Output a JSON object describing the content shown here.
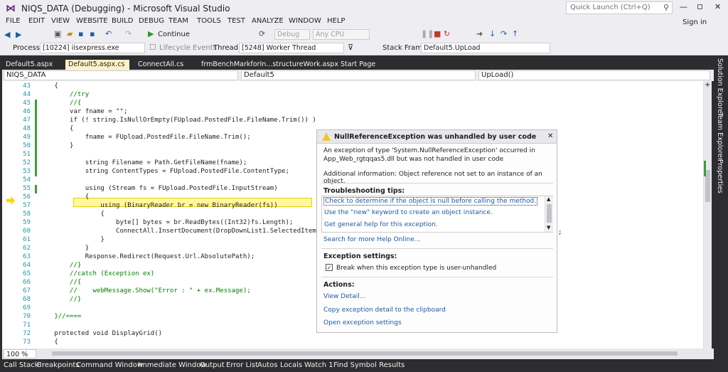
{
  "titlebar": {
    "title": "NIQS_DATA (Debugging) - Microsoft Visual Studio",
    "quick_launch": "Quick Launch (Ctrl+Q)",
    "signin": "Sign in",
    "minimize": "—",
    "restore": "▫",
    "close": "✕"
  },
  "menu": [
    "FILE",
    "EDIT",
    "VIEW",
    "WEBSITE",
    "BUILD",
    "DEBUG",
    "TEAM",
    "TOOLS",
    "TEST",
    "ANALYZE",
    "WINDOW",
    "HELP"
  ],
  "toolbar": {
    "continue": "Continue",
    "config": "Debug",
    "platform": "Any CPU"
  },
  "debugbar": {
    "process_label": "Process:",
    "process_value": "[10224] iisexpress.exe",
    "lifecycle": "Lifecycle Events",
    "thread_label": "Thread:",
    "thread_value": "[5248] Worker Thread",
    "stack_label": "Stack Frame:",
    "stack_value": "Default5.UpLoad"
  },
  "tabs": [
    "Default5.aspx",
    "Default5.aspx.cs",
    "ConnectAll.cs",
    "frmBenchMarkforIn...structureWork.aspx",
    "Start Page"
  ],
  "nav": {
    "project": "NIQS_DATA",
    "class": "Default5",
    "member": "UpLoad()"
  },
  "zoom": "100 %",
  "lines": [
    {
      "n": "43",
      "t": "        {"
    },
    {
      "n": "44",
      "t": "            //try"
    },
    {
      "n": "45",
      "t": "            //{"
    },
    {
      "n": "46",
      "t": "            var fname = \"\";"
    },
    {
      "n": "47",
      "t": "            if (! string.IsNullOrEmpty(FUpload.PostedFile.FileName.Trim()) )"
    },
    {
      "n": "48",
      "t": "            {"
    },
    {
      "n": "49",
      "t": "                fname = FUpload.PostedFile.FileName.Trim();"
    },
    {
      "n": "50",
      "t": "            }"
    },
    {
      "n": "51",
      "t": ""
    },
    {
      "n": "52",
      "t": "                string Filename = Path.GetFileName(fname);"
    },
    {
      "n": "53",
      "t": "                string ContentTypes = FUpload.PostedFile.ContentType;"
    },
    {
      "n": "54",
      "t": ""
    },
    {
      "n": "55",
      "t": "                using (Stream fs = FUpload.PostedFile.InputStream)"
    },
    {
      "n": "56",
      "t": "                {"
    },
    {
      "n": "57",
      "t": "                    using (BinaryReader br = new BinaryReader(fs))"
    },
    {
      "n": "58",
      "t": "                    {"
    },
    {
      "n": "59",
      "t": "                        byte[] bytes = br.ReadBytes((Int32)fs.Length);"
    },
    {
      "n": "60",
      "t": "                        ConnectAll.InsertDocument(DropDownList1.SelectedItem.T"
    },
    {
      "n": "61",
      "t": "                    }"
    },
    {
      "n": "62",
      "t": "                }"
    },
    {
      "n": "63",
      "t": "                Response.Redirect(Request.Url.AbsolutePath);"
    },
    {
      "n": "64",
      "t": "            //}"
    },
    {
      "n": "65",
      "t": "            //catch (Exception ex)"
    },
    {
      "n": "66",
      "t": "            //{"
    },
    {
      "n": "67",
      "t": "            //    webMessage.Show(\"Error : \" + ex.Message);"
    },
    {
      "n": "68",
      "t": "            //}"
    },
    {
      "n": "69",
      "t": ""
    },
    {
      "n": "70",
      "t": "        }//===="
    },
    {
      "n": "71",
      "t": ""
    },
    {
      "n": "72",
      "t": "        protected void DisplayGrid()"
    },
    {
      "n": "73",
      "t": "        {"
    }
  ],
  "code_tail": ";",
  "exception": {
    "title": "NullReferenceException was unhandled by user code",
    "desc1": "An exception of type 'System.NullReferenceException' occurred in",
    "desc2": "App_Web_rgtqqas5.dll but was not handled in user code",
    "info": "Additional information: Object reference not set to an instance of an object.",
    "tips_title": "Troubleshooting tips:",
    "tips": [
      "Check to determine if the object is null before calling the method.",
      "Use the \"new\" keyword to create an object instance.",
      "Get general help for this exception."
    ],
    "help_online": "Search for more Help Online...",
    "settings_title": "Exception settings:",
    "checkbox_label": "Break when this exception type is user-unhandled",
    "actions_title": "Actions:",
    "actions": [
      "View Detail...",
      "Copy exception detail to the clipboard",
      "Open exception settings"
    ]
  },
  "right_panels": [
    "Solution Explorer",
    "Team Explorer",
    "Properties"
  ],
  "bottom_tabs": [
    "Call Stack",
    "Breakpoints",
    "Command Window",
    "Immediate Window",
    "Output",
    "Error List",
    "Autos",
    "Locals",
    "Watch 1",
    "Find Symbol Results"
  ]
}
